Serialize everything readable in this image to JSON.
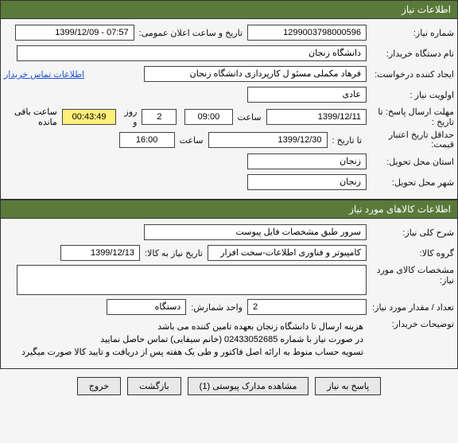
{
  "section1": {
    "title": "اطلاعات نیاز"
  },
  "need_no": {
    "label": "شماره نیاز:",
    "value": "1299003798000596"
  },
  "announce": {
    "label": "تاریخ و ساعت اعلان عمومی:",
    "value": "07:57 - 1399/12/09"
  },
  "buyer": {
    "label": "نام دستگاه خریدار:",
    "value": "دانشگاه زنجان"
  },
  "requester": {
    "label": "ایجاد کننده درخواست:",
    "value": "فرهاد مکملی مسئو ل کارپردازی دانشگاه زنجان"
  },
  "contact_link": "اطلاعات تماس خریدار",
  "priority": {
    "label": "اولویت نیاز :",
    "value": "عادی"
  },
  "deadline": {
    "label": "مهلت ارسال پاسخ:  تا تاریخ :",
    "date": "1399/12/11",
    "time_label": "ساعت",
    "time": "09:00",
    "days": "2",
    "days_label": "روز و",
    "remain": "00:43:49",
    "remain_label": "ساعت باقی مانده"
  },
  "validity": {
    "label": "حداقل تاریخ اعتبار قیمت:",
    "sublabel": "تا تاریخ :",
    "date": "1399/12/30",
    "time_label": "ساعت",
    "time": "16:00"
  },
  "province": {
    "label": "استان محل تحویل:",
    "value": "زنجان"
  },
  "city": {
    "label": "شهر محل تحویل:",
    "value": "زنجان"
  },
  "section2": {
    "title": "اطلاعات کالاهای مورد نیاز"
  },
  "desc": {
    "label": "شرح کلی نیاز:",
    "value": "سرور طبق مشخصات فایل پیوست"
  },
  "group": {
    "label": "گروه کالا:",
    "value": "کامپیوتر و فناوری اطلاعات-سخت افزار"
  },
  "need_date": {
    "label": "تاریخ نیاز به کالا:",
    "value": "1399/12/13"
  },
  "spec": {
    "label": "مشخصات کالای مورد نیاز:",
    "value": ""
  },
  "qty": {
    "label": "تعداد / مقدار مورد نیاز:",
    "value": "2"
  },
  "unit": {
    "label": "واحد شمارش:",
    "value": "دستگاه"
  },
  "notes": {
    "label": "توضیحات خریدار:",
    "line1": "هزینه ارسال تا دانشگاه زنجان بعهده تامین کننده می باشد",
    "line2": "در صورت نیاز با شماره 02433052685 (خانم سیفایی) تماس حاصل نمایید",
    "line3": "تسویه حساب منوط به ارائه اصل فاکتور و طی یک هفته پس از دریافت و تایید کالا صورت میگیرد"
  },
  "buttons": {
    "reply": "پاسخ به نیاز",
    "attach": "مشاهده مدارک پیوستی (1)",
    "back": "بازگشت",
    "exit": "خروج"
  }
}
